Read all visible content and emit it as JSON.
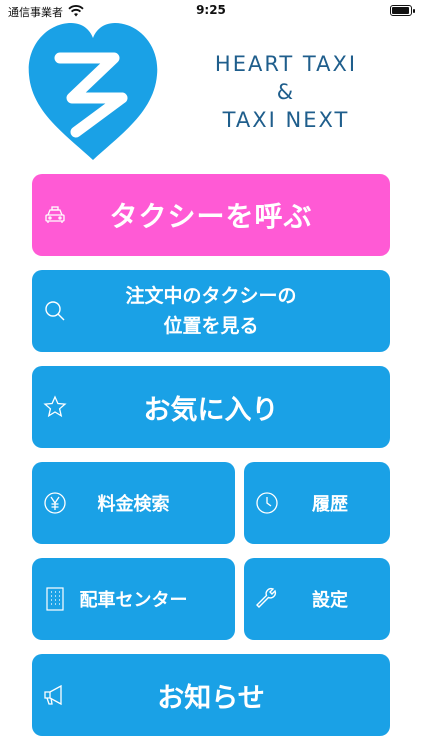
{
  "status_bar": {
    "carrier": "通信事業者",
    "time": "9:25"
  },
  "brand": {
    "line1": "HEART TAXI",
    "line2": "&",
    "line3": "TAXI NEXT"
  },
  "menu": {
    "call_taxi": "タクシーを呼ぶ",
    "track_line1": "注文中のタクシーの",
    "track_line2": "位置を見る",
    "favorites": "お気に入り",
    "fare_search": "料金検索",
    "history": "履歴",
    "dispatch_center": "配車センター",
    "settings": "設定",
    "notices": "お知らせ"
  },
  "icons": {
    "call_taxi": "taxi-icon",
    "track": "search-icon",
    "favorites": "star-icon",
    "fare_search": "yen-icon",
    "history": "clock-icon",
    "dispatch_center": "building-icon",
    "settings": "wrench-icon",
    "notices": "megaphone-icon"
  },
  "colors": {
    "primary": "#1aa1e6",
    "accent": "#ff5ad5",
    "brand_text": "#1f5e8c"
  }
}
